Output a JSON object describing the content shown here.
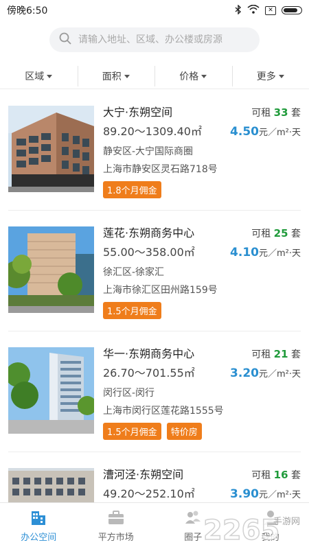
{
  "status": {
    "time": "傍晚6:50"
  },
  "search": {
    "placeholder": "请输入地址、区域、办公楼或房源"
  },
  "filters": [
    {
      "label": "区域"
    },
    {
      "label": "面积"
    },
    {
      "label": "价格"
    },
    {
      "label": "更多"
    }
  ],
  "listings": [
    {
      "name": "大宁·东朔空间",
      "avail_prefix": "可租",
      "avail_count": "33",
      "avail_unit": "套",
      "area": "89.20～1309.40㎡",
      "price": "4.50",
      "price_unit": "元／m²·天",
      "district": "静安区-大宁国际商圈",
      "address": "上海市静安区灵石路718号",
      "tags": [
        "1.8个月佣金"
      ]
    },
    {
      "name": "莲花·东朔商务中心",
      "avail_prefix": "可租",
      "avail_count": "25",
      "avail_unit": "套",
      "area": "55.00～358.00㎡",
      "price": "4.10",
      "price_unit": "元／m²·天",
      "district": "徐汇区-徐家汇",
      "address": "上海市徐汇区田州路159号",
      "tags": [
        "1.5个月佣金"
      ]
    },
    {
      "name": "华一·东朔商务中心",
      "avail_prefix": "可租",
      "avail_count": "21",
      "avail_unit": "套",
      "area": "26.70～701.55㎡",
      "price": "3.20",
      "price_unit": "元／m²·天",
      "district": "闵行区-闵行",
      "address": "上海市闵行区莲花路1555号",
      "tags": [
        "1.5个月佣金",
        "特价房"
      ]
    },
    {
      "name": "漕河泾·东朔空间",
      "avail_prefix": "可租",
      "avail_count": "16",
      "avail_unit": "套",
      "area": "49.20～252.10㎡",
      "price": "3.90",
      "price_unit": "元／m²·天",
      "district": "",
      "address": "",
      "tags": []
    }
  ],
  "tabs": [
    {
      "label": "办公空间",
      "active": true,
      "icon": "building-icon"
    },
    {
      "label": "平方市场",
      "active": false,
      "icon": "briefcase-icon"
    },
    {
      "label": "圈子",
      "active": false,
      "icon": "people-icon"
    },
    {
      "label": "我的",
      "active": false,
      "icon": "person-icon"
    }
  ],
  "watermark": {
    "number": "2265",
    "text": "手游网"
  },
  "colors": {
    "accent": "#2d8fd5",
    "count_green": "#1f9a3a",
    "tag_orange": "#ef7d1b",
    "price_blue": "#2a8fd0"
  }
}
